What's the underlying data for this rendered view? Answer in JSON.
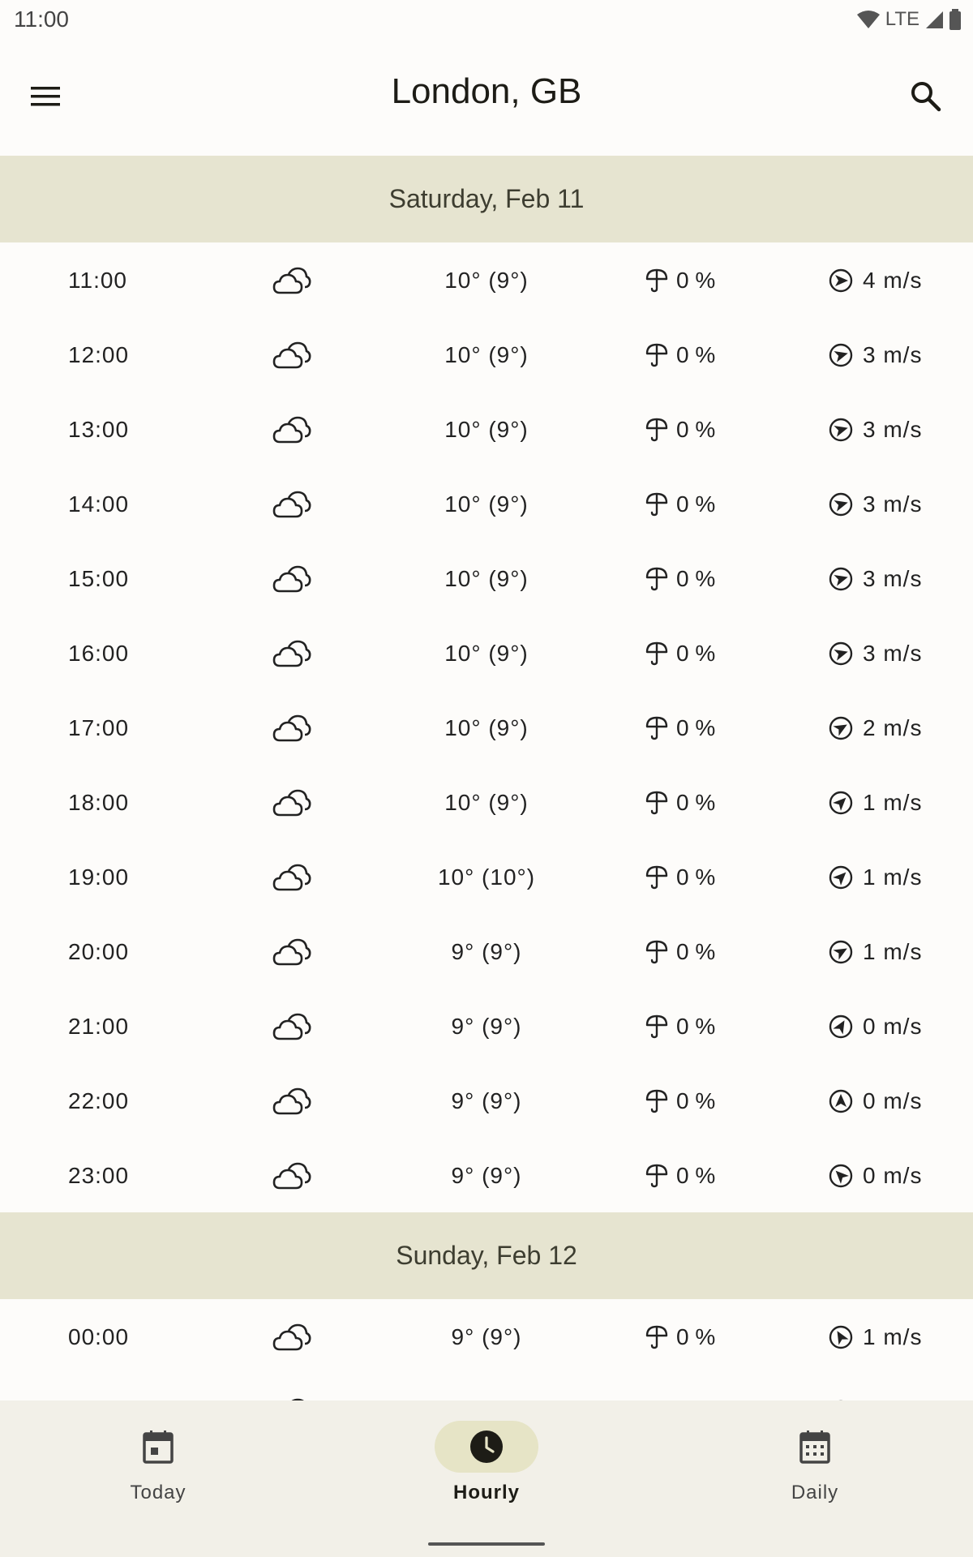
{
  "status": {
    "time": "11:00",
    "network": "LTE"
  },
  "app_bar": {
    "title": "London, GB"
  },
  "days": [
    {
      "label": "Saturday, Feb 11"
    },
    {
      "label": "Sunday, Feb 12"
    }
  ],
  "rows": [
    {
      "time": "11:00",
      "temp": "10° (9°)",
      "precip": "0 %",
      "wind": "4 m/s",
      "wind_dir_deg": 90
    },
    {
      "time": "12:00",
      "temp": "10° (9°)",
      "precip": "0 %",
      "wind": "3 m/s",
      "wind_dir_deg": 75
    },
    {
      "time": "13:00",
      "temp": "10° (9°)",
      "precip": "0 %",
      "wind": "3 m/s",
      "wind_dir_deg": 75
    },
    {
      "time": "14:00",
      "temp": "10° (9°)",
      "precip": "0 %",
      "wind": "3 m/s",
      "wind_dir_deg": 75
    },
    {
      "time": "15:00",
      "temp": "10° (9°)",
      "precip": "0 %",
      "wind": "3 m/s",
      "wind_dir_deg": 75
    },
    {
      "time": "16:00",
      "temp": "10° (9°)",
      "precip": "0 %",
      "wind": "3 m/s",
      "wind_dir_deg": 75
    },
    {
      "time": "17:00",
      "temp": "10° (9°)",
      "precip": "0 %",
      "wind": "2 m/s",
      "wind_dir_deg": 60
    },
    {
      "time": "18:00",
      "temp": "10° (9°)",
      "precip": "0 %",
      "wind": "1 m/s",
      "wind_dir_deg": 45
    },
    {
      "time": "19:00",
      "temp": "10° (10°)",
      "precip": "0 %",
      "wind": "1 m/s",
      "wind_dir_deg": 45
    },
    {
      "time": "20:00",
      "temp": "9° (9°)",
      "precip": "0 %",
      "wind": "1 m/s",
      "wind_dir_deg": 60
    },
    {
      "time": "21:00",
      "temp": "9° (9°)",
      "precip": "0 %",
      "wind": "0 m/s",
      "wind_dir_deg": 30
    },
    {
      "time": "22:00",
      "temp": "9° (9°)",
      "precip": "0 %",
      "wind": "0 m/s",
      "wind_dir_deg": 0
    },
    {
      "time": "23:00",
      "temp": "9° (9°)",
      "precip": "0 %",
      "wind": "0 m/s",
      "wind_dir_deg": -45
    },
    {
      "time": "00:00",
      "temp": "9° (9°)",
      "precip": "0 %",
      "wind": "1 m/s",
      "wind_dir_deg": -30
    }
  ],
  "icons": {
    "condition": "cloudy-icon",
    "precip": "umbrella-icon",
    "wind": "wind-direction-icon"
  },
  "nav": {
    "today": "Today",
    "hourly": "Hourly",
    "daily": "Daily"
  },
  "colors": {
    "header_bg": "#e6e4d0",
    "active_pill": "#e6e4c6",
    "nav_bg": "#f2f0e8"
  }
}
